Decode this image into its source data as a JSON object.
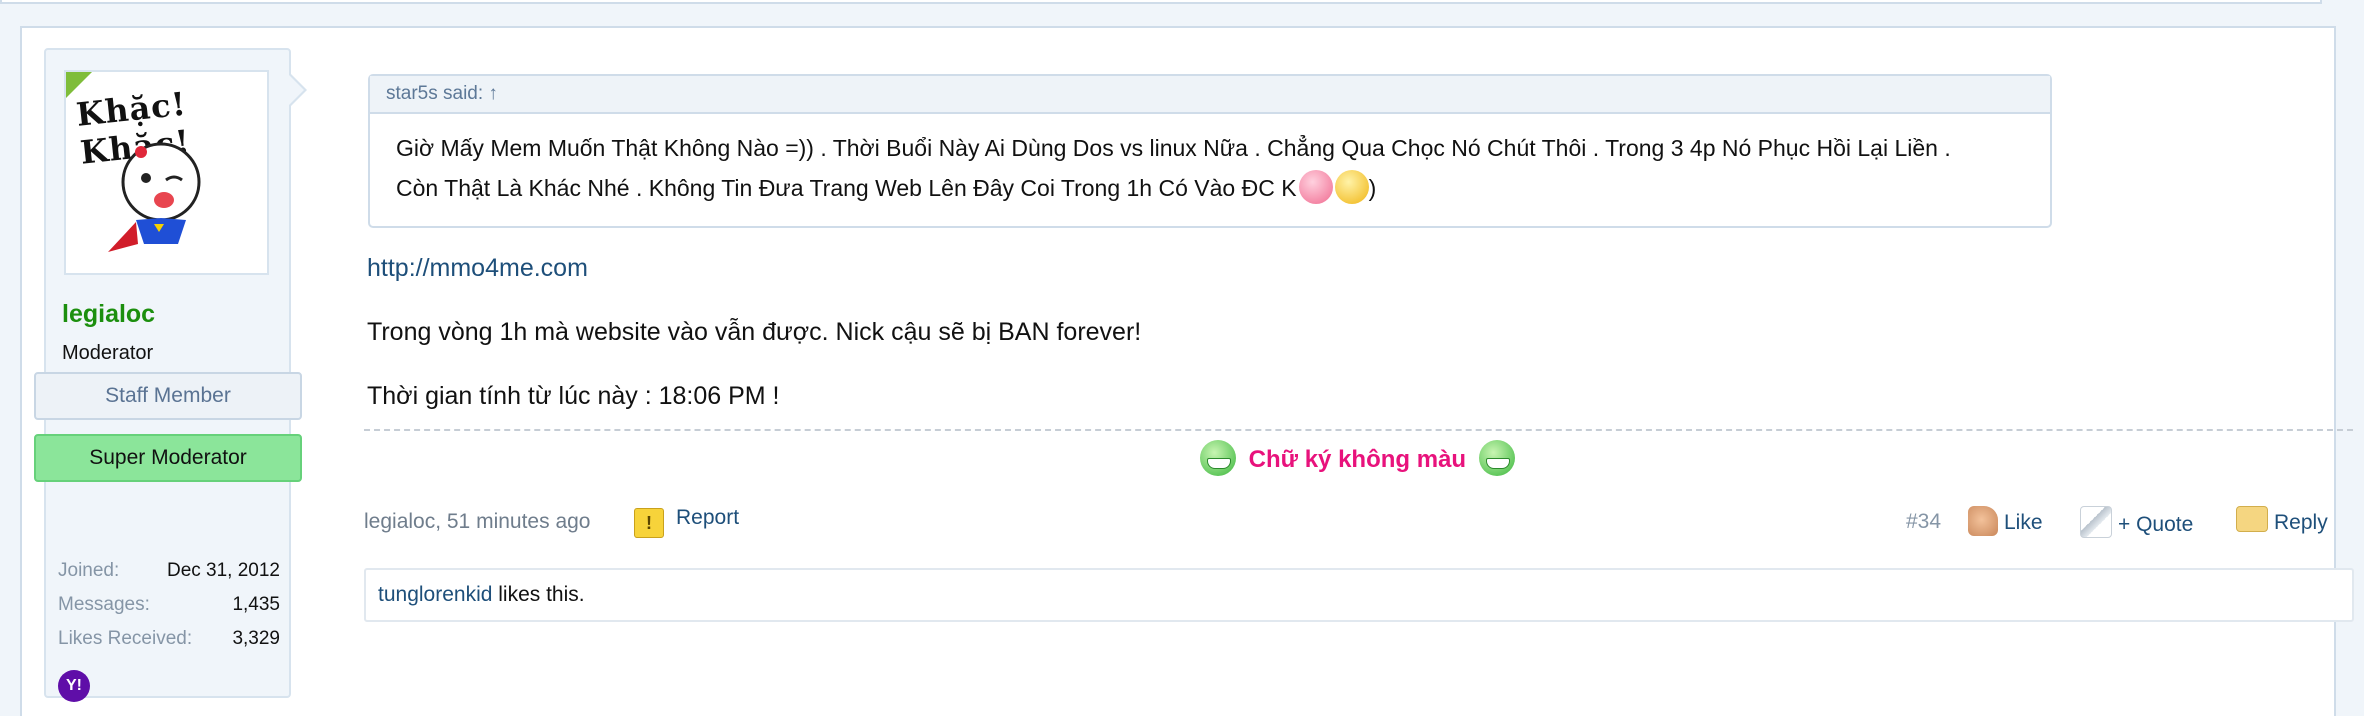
{
  "user": {
    "avatar_text": "Khặc! Khặc!",
    "username": "legialoc",
    "title": "Moderator",
    "staff_badge": "Staff Member",
    "role_badge": "Super Moderator",
    "stats": [
      {
        "label": "Joined:",
        "value": "Dec 31, 2012"
      },
      {
        "label": "Messages:",
        "value": "1,435"
      },
      {
        "label": "Likes Received:",
        "value": "3,329"
      }
    ],
    "contact_icon": "yahoo-icon",
    "contact_icon_glyph": "Y!"
  },
  "quote": {
    "header": "star5s said: ↑",
    "line1": "Giờ Mấy Mem Muốn Thật Không Nào =)) . Thời Buổi Này Ai Dùng Dos vs linux Nữa . Chẳng Qua Chọc Nó Chút Thôi . Trong 3 4p Nó Phục Hồi Lại Liền .",
    "line2": "Còn Thật Là Khác Nhé . Không Tin Đưa Trang Web Lên Đây Coi Trong 1h Có Vào ĐC K",
    "line2_end": ")"
  },
  "post": {
    "link": "http://mmo4me.com",
    "line1": "Trong vòng 1h mà website vào vẫn được. Nick cậu sẽ bị BAN forever!",
    "line2": "Thời gian tính từ lúc này : 18:06 PM !",
    "signature": "Chữ ký không màu",
    "author_time": "legialoc, 51 minutes ago",
    "report": "Report",
    "post_number": "#34",
    "like": "Like",
    "quote": "+ Quote",
    "reply": "Reply",
    "likes_user": "tunglorenkid",
    "likes_text": " likes this."
  },
  "colors": {
    "username": "#1c8f0e",
    "signature": "#e8127c",
    "link": "#1e4f7a",
    "super_moderator_badge": "#8be59a"
  }
}
